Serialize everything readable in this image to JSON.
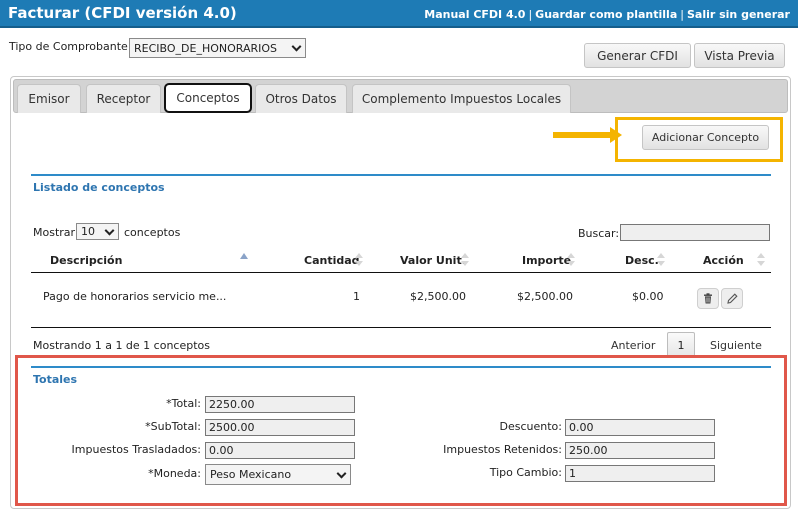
{
  "header": {
    "title": "Facturar (CFDI versión 4.0)",
    "links": [
      "Manual CFDI 4.0",
      "Guardar como plantilla",
      "Salir sin generar"
    ],
    "separator": "|"
  },
  "comprobante": {
    "label": "Tipo de Comprobante:",
    "value": "RECIBO_DE_HONORARIOS"
  },
  "actions": {
    "generar": "Generar CFDI",
    "vista_previa": "Vista Previa"
  },
  "tabs": [
    {
      "label": "Emisor",
      "active": false
    },
    {
      "label": "Receptor",
      "active": false
    },
    {
      "label": "Conceptos",
      "active": true
    },
    {
      "label": "Otros Datos",
      "active": false
    },
    {
      "label": "Complemento Impuestos Locales",
      "active": false
    }
  ],
  "conceptos": {
    "add_button": "Adicionar Concepto",
    "section_title": "Listado de conceptos",
    "show_prefix": "Mostrar",
    "page_size": "10",
    "show_suffix": "conceptos",
    "search_label": "Buscar:",
    "search_value": "",
    "columns": {
      "descripcion": "Descripción",
      "cantidad": "Cantidad",
      "valor_unit": "Valor Unit.",
      "importe": "Importe",
      "desc": "Desc.",
      "accion": "Acción"
    },
    "rows": [
      {
        "descripcion": "Pago de honorarios servicio me...",
        "cantidad": "1",
        "valor_unit": "$2,500.00",
        "importe": "$2,500.00",
        "desc": "$0.00"
      }
    ],
    "info": "Mostrando 1 a 1 de 1 conceptos",
    "pager": {
      "prev": "Anterior",
      "current": "1",
      "next": "Siguiente"
    }
  },
  "totales": {
    "section_title": "Totales",
    "total_label": "*Total:",
    "total": "2250.00",
    "subtotal_label": "*SubTotal:",
    "subtotal": "2500.00",
    "trasladados_label": "Impuestos Trasladados:",
    "trasladados": "0.00",
    "moneda_label": "*Moneda:",
    "moneda": "Peso Mexicano",
    "descuento_label": "Descuento:",
    "descuento": "0.00",
    "retenidos_label": "Impuestos Retenidos:",
    "retenidos": "250.00",
    "tipo_cambio_label": "Tipo Cambio:",
    "tipo_cambio": "1"
  },
  "colors": {
    "header_bg": "#1e7bb5",
    "section_title": "#2e75b0",
    "highlight_yellow": "#f4b400",
    "highlight_red": "#e0574a"
  }
}
